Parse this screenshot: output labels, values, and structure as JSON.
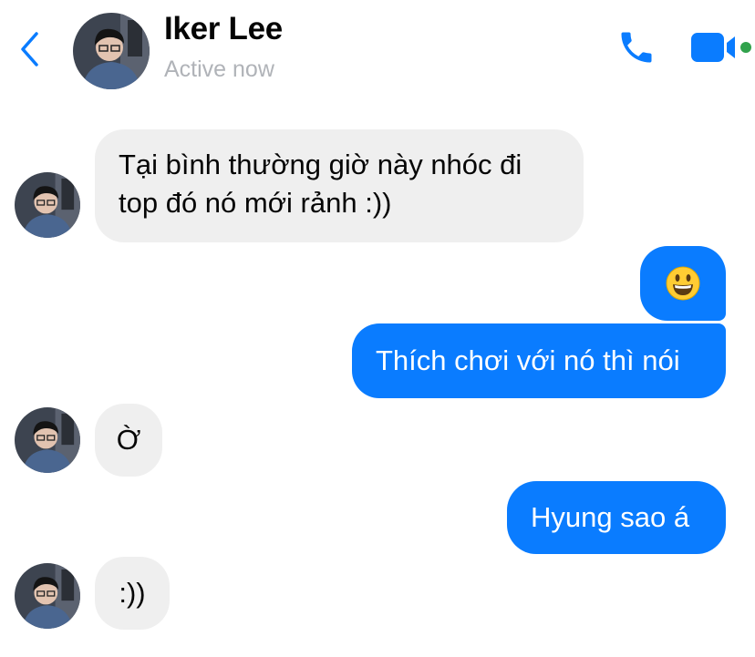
{
  "header": {
    "name": "Iker Lee",
    "status": "Active now"
  },
  "colors": {
    "accent": "#0a7cff",
    "incoming_bubble": "#efefef",
    "active_dot": "#31a24c"
  },
  "icons": [
    "back-chevron-icon",
    "phone-icon",
    "video-camera-icon"
  ],
  "messages": [
    {
      "direction": "incoming",
      "lines": [
        "Tại bình thường giờ này nhóc đi",
        "top đó nó mới rảnh :))"
      ]
    },
    {
      "direction": "outgoing",
      "text": "😃"
    },
    {
      "direction": "outgoing",
      "text": "Thích chơi với nó thì nói"
    },
    {
      "direction": "incoming",
      "text": "Ờ"
    },
    {
      "direction": "outgoing",
      "text": "Hyung sao á"
    },
    {
      "direction": "incoming",
      "text": ":))"
    }
  ]
}
